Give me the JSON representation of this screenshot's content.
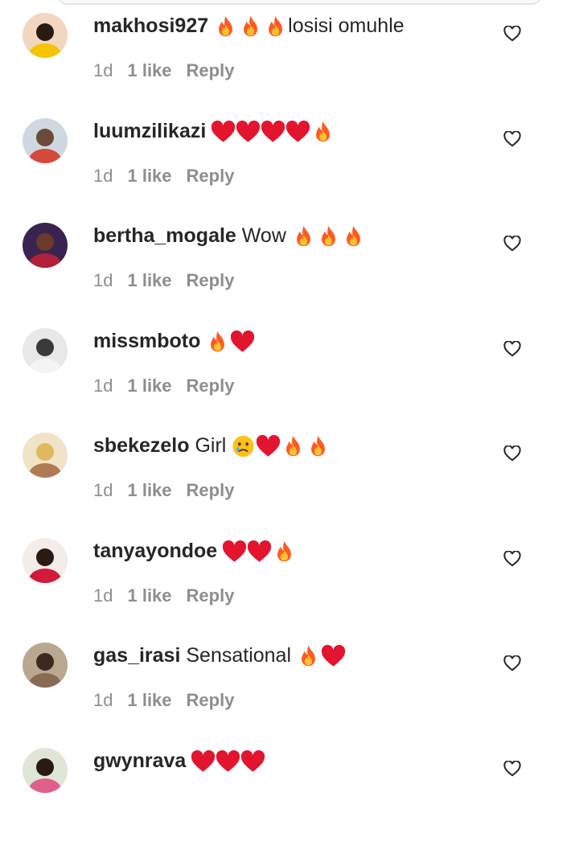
{
  "comments": [
    {
      "username": "makhosi927",
      "text": "",
      "emojis": [
        "fire",
        "fire",
        "fire"
      ],
      "text_after": "losisi omuhle",
      "time": "1d",
      "likes": "1 like",
      "reply": "Reply",
      "avatar": "avatar-woman-yellow"
    },
    {
      "username": "luumzilikazi",
      "text": "",
      "emojis": [
        "heart",
        "heart",
        "heart",
        "heart",
        "fire"
      ],
      "text_after": "",
      "time": "1d",
      "likes": "1 like",
      "reply": "Reply",
      "avatar": "avatar-man-red-shirt"
    },
    {
      "username": "bertha_mogale",
      "text": "Wow",
      "emojis": [
        "fire",
        "fire",
        "fire"
      ],
      "text_after": "",
      "time": "1d",
      "likes": "1 like",
      "reply": "Reply",
      "avatar": "avatar-group-dark"
    },
    {
      "username": "missmboto",
      "text": "",
      "emojis": [
        "fire",
        "heart"
      ],
      "text_after": "",
      "time": "1d",
      "likes": "1 like",
      "reply": "Reply",
      "avatar": "avatar-bw-portrait"
    },
    {
      "username": "sbekezelo",
      "text": "Girl",
      "emojis": [
        "crying-face",
        "heart",
        "fire",
        "fire"
      ],
      "text_after": "",
      "time": "1d",
      "likes": "1 like",
      "reply": "Reply",
      "avatar": "avatar-blonde-woman"
    },
    {
      "username": "tanyayondoe",
      "text": "",
      "emojis": [
        "heart",
        "heart",
        "fire"
      ],
      "text_after": "",
      "time": "1d",
      "likes": "1 like",
      "reply": "Reply",
      "avatar": "avatar-woman-red-lips"
    },
    {
      "username": "gas_irasi",
      "text": "Sensational",
      "emojis": [
        "fire",
        "heart"
      ],
      "text_after": "",
      "time": "1d",
      "likes": "1 like",
      "reply": "Reply",
      "avatar": "avatar-group-photo"
    },
    {
      "username": "gwynrava",
      "text": "",
      "emojis": [
        "heart",
        "heart",
        "heart"
      ],
      "text_after": "",
      "time": "",
      "likes": "",
      "reply": "",
      "avatar": "avatar-woman-pink-dress"
    }
  ]
}
